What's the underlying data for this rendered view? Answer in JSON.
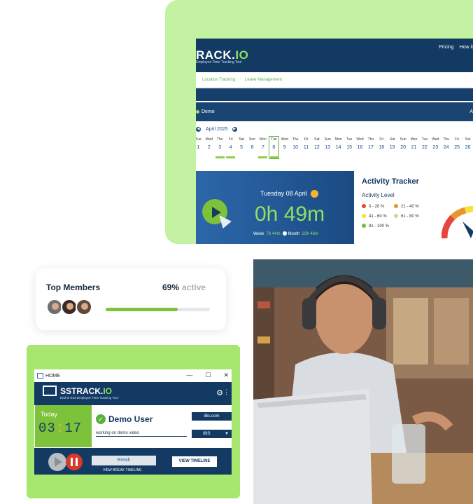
{
  "dashboard": {
    "logo_main": "RACK.",
    "logo_io": "IO",
    "tagline": "Employee Time Tracking Tool",
    "nav": [
      "Pricing",
      "How it"
    ],
    "tabs": [
      "Location Tracking",
      "Leave Management"
    ],
    "demo_label": "Demo",
    "demo_right": "A",
    "month": "April 2025",
    "calendar": {
      "days": [
        "Tue",
        "Wed",
        "Thu",
        "Fri",
        "Sat",
        "Sun",
        "Mon",
        "Tue",
        "Wed",
        "Thu",
        "Fri",
        "Sat",
        "Sun",
        "Mon",
        "Tue",
        "Wed",
        "Thu",
        "Fri",
        "Sat",
        "Sun",
        "Mon",
        "Tue",
        "Wed",
        "Thu",
        "Fri",
        "Sat"
      ],
      "dates": [
        "1",
        "2",
        "3",
        "4",
        "5",
        "6",
        "7",
        "8",
        "9",
        "10",
        "11",
        "12",
        "13",
        "14",
        "15",
        "16",
        "17",
        "18",
        "19",
        "20",
        "21",
        "22",
        "23",
        "24",
        "25",
        "26"
      ],
      "active_dates": [
        "3",
        "4",
        "7",
        "8"
      ],
      "today": "8"
    },
    "timer": {
      "date": "Tuesday  08  April",
      "time": "0h 49m",
      "week_label": "Week",
      "week_value": "7h 44m",
      "month_label": "Month",
      "month_value": "23h 46m"
    },
    "activity": {
      "title": "Activity Tracker",
      "level_label": "Activity Level",
      "legend": [
        {
          "label": "0 - 20 %",
          "color": "#e8453c"
        },
        {
          "label": "21 - 40 %",
          "color": "#e8962c"
        },
        {
          "label": "41 - 60 %",
          "color": "#f2e23b"
        },
        {
          "label": "61 - 80 %",
          "color": "#b9e38b"
        },
        {
          "label": "81 - 100 %",
          "color": "#6cc04a"
        }
      ]
    }
  },
  "members": {
    "title": "Top Members",
    "percent": "69%",
    "active_label": "active",
    "progress": 0.69
  },
  "widget": {
    "title": "HOME",
    "controls": [
      "—",
      "☐",
      "✕"
    ],
    "logo_main": "SSTRACK.",
    "logo_io": "IO",
    "tagline": "End-to-End Employee Time Tracking Tool",
    "today_label": "Today",
    "clock_h": "03",
    "clock_sep": ":",
    "clock_m": "17",
    "user": "Demo User",
    "note": "working on demo video",
    "domain": "i8is.com",
    "org": "I8IS",
    "break_label": "Break",
    "view_timeline": "VIEW TIMELINE",
    "view_break": "VIEW BREAK TIMELINE"
  },
  "colors": {
    "navy": "#123a63",
    "green": "#7cc23a",
    "light_green": "#c3f2a2"
  }
}
